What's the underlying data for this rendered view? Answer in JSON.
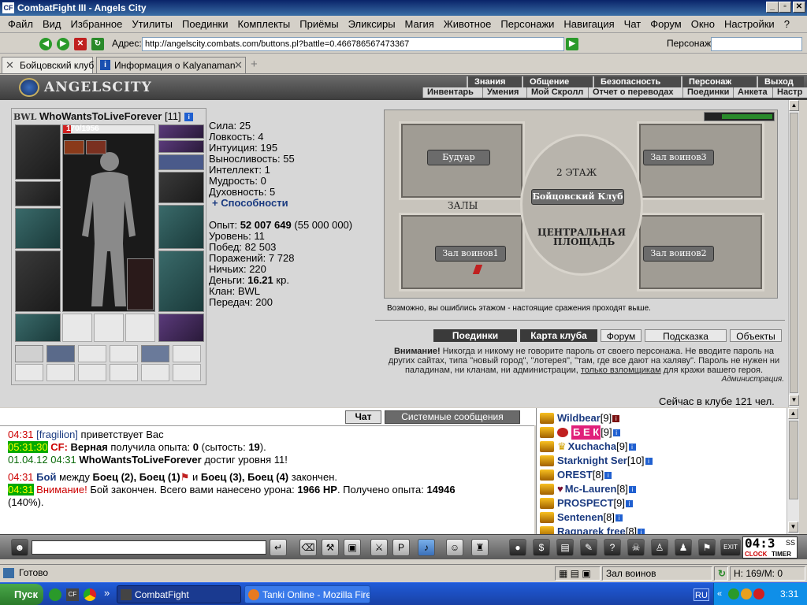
{
  "window": {
    "title": "CombatFight III - Angels City",
    "app_icon": "CF",
    "min": "_",
    "max": "▫",
    "close": "✕"
  },
  "menu": [
    "Файл",
    "Вид",
    "Избранное",
    "Утилиты",
    "Поединки",
    "Комплекты",
    "Приёмы",
    "Эликсиры",
    "Магия",
    "Животное",
    "Персонажи",
    "Навигация",
    "Чат",
    "Форум",
    "Окно",
    "Настройки",
    "?"
  ],
  "address": {
    "label": "Адрес:",
    "url": "http://angelscity.combats.com/buttons.pl?battle=0.466786567473367",
    "persona_label": "Персонаж:",
    "persona_value": ""
  },
  "tabs": [
    {
      "label": "Бойцовский клуб",
      "active": true
    },
    {
      "label": "Информация о Kalyanaman",
      "active": false
    }
  ],
  "game": {
    "logo": "ANGELSCITY",
    "top_links": [
      "Знания",
      "Общение",
      "Безопасность",
      "Персонаж",
      "Выход"
    ],
    "sub_links": [
      "Инвентарь",
      "Умения",
      "Мой Скролл",
      "Отчет о переводах",
      "Поединки",
      "Анкета",
      "Настр"
    ]
  },
  "character": {
    "clan_tag": "BWL",
    "name": "WhoWantsToLiveForever",
    "level": "[11]",
    "hp": "170/1956",
    "hp_fraction": 0.087
  },
  "stats": [
    {
      "label": "Сила:",
      "value": "25"
    },
    {
      "label": "Ловкость:",
      "value": "4"
    },
    {
      "label": "Интуиция:",
      "value": "195"
    },
    {
      "label": "Выносливость:",
      "value": "55"
    },
    {
      "label": "Интеллект:",
      "value": "1"
    },
    {
      "label": "Мудрость:",
      "value": "0"
    },
    {
      "label": "Духовность:",
      "value": "5"
    }
  ],
  "abilities_link": "+ Способности",
  "info": {
    "exp_label": "Опыт:",
    "exp_value": "52 007 649",
    "exp_next": "(55 000 000)",
    "level_label": "Уровень:",
    "level_value": "11",
    "wins_label": "Побед:",
    "wins_value": "82 503",
    "losses_label": "Поражений:",
    "losses_value": "7 728",
    "draws_label": "Ничьих:",
    "draws_value": "220",
    "money_label": "Деньги:",
    "money_value": "16.21",
    "money_unit": "кр.",
    "clan_label": "Клан:",
    "clan_value": "BWL",
    "transfers_label": "Передач:",
    "transfers_value": "200"
  },
  "map": {
    "rooms": {
      "boudoir": "Будуар",
      "hall3": "Зал воинов3",
      "floor2": "2 ЭТАЖ",
      "club": "Бойцовский Клуб",
      "halls": "ЗАЛЫ",
      "plaza_line1": "ЦЕНТРАЛЬНАЯ",
      "plaza_line2": "ПЛОЩАДЬ",
      "hall1": "Зал воинов1",
      "hall2": "Зал воинов2"
    },
    "note": "Возможно, вы ошиблись этажом - настоящие сражения проходят выше."
  },
  "bottom_buttons": [
    "Поединки",
    "Карта клуба",
    "Форум",
    "Подсказка",
    "Объекты"
  ],
  "warning": {
    "strong": "Внимание!",
    "text1": " Никогда и никому не говорите пароль от своего персонажа. Не вводите пароль на других сайтах, типа \"новый город\", \"лотерея\", \"там, где все дают на халяву\". Пароль не нужен ни паладинам, ни кланам, ни администрации, ",
    "link": "только взломщикам",
    "text2": " для кражи вашего героя.",
    "signature": "Администрация.",
    "online": "Сейчас в клубе 121 чел."
  },
  "chat_tabs": [
    "Чат",
    "Системные сообщения"
  ],
  "chat": {
    "l1": {
      "time": "04:31",
      "name": "[fragilion]",
      "text": " приветствует Вас"
    },
    "l2": {
      "time": "05:31:30",
      "prefix": "CF:",
      "who": "Верная",
      "mid": " получила опыта: ",
      "exp": "0",
      "rest1": " (сытость: ",
      "sat": "19",
      "rest2": ")."
    },
    "l3": {
      "date": "01.04.12",
      "time": "04:31",
      "name": "WhoWantsToLiveForever",
      "text": " достиг уровня 11!"
    },
    "l4": {
      "time": "04:31",
      "battle": "Бой",
      "between": " между ",
      "f1": "Боец (2), Боец (1)",
      "and": " и ",
      "f2": "Боец (3), Боец (4)",
      "end": " закончен."
    },
    "l5": {
      "time": "04:31",
      "warn": "Внимание!",
      "text1": " Бой закончен. Всего вами нанесено урона: ",
      "dmg": "1966 HP",
      "text2": ". Получено опыта: ",
      "exp": "14946",
      "pct": "(140%)."
    }
  },
  "users": [
    {
      "name": "Wildbear",
      "level": "[9]"
    },
    {
      "name": "Б Е К",
      "level": "[9]"
    },
    {
      "name": "Xuchacha",
      "level": "[9]"
    },
    {
      "name": "Starknight Ser",
      "level": "[10]"
    },
    {
      "name": "OREST",
      "level": "[8]"
    },
    {
      "name": "Mc-Lauren",
      "level": "[8]"
    },
    {
      "name": "PROSPECT",
      "level": "[9]"
    },
    {
      "name": "Sentenen",
      "level": "[8]"
    },
    {
      "name": "Ragnarek free",
      "level": "[8]"
    }
  ],
  "clock": {
    "time": "04:3",
    "sub": "SS",
    "clock_label": "CLOCK",
    "timer_label": "TIMER"
  },
  "status": {
    "ready": "Готово",
    "location": "Зал воинов",
    "hp": "Н: 169/М: 0"
  },
  "taskbar": {
    "start": "Пуск",
    "tasks": [
      "CombatFight",
      "Tanki Online - Mozilla Fire..."
    ],
    "lang": "RU",
    "time": "3:31"
  },
  "icons": {
    "back": "◀",
    "forward": "▶",
    "refresh": "↻",
    "stop": "✕",
    "go": "▶",
    "close_tab": "✕",
    "add_tab": "+"
  }
}
